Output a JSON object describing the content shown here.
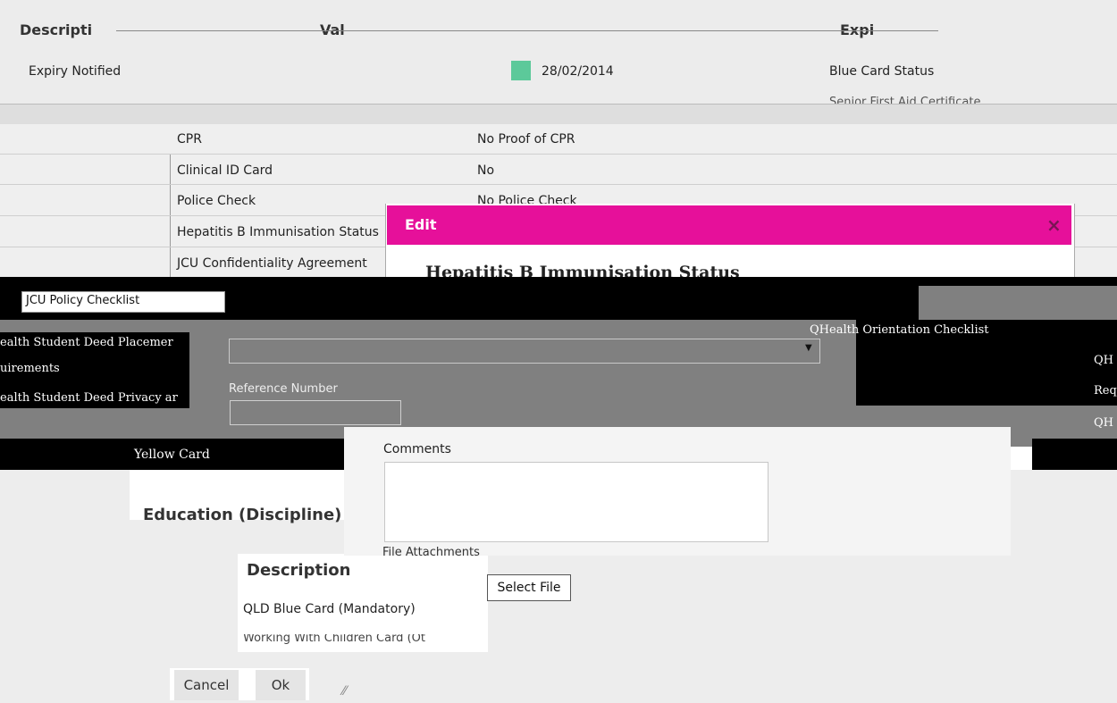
{
  "top_table": {
    "header_labels": [
      "Descripti",
      "Val",
      "Expi"
    ],
    "row": {
      "description": "Expiry Notified",
      "value": "28/02/2014",
      "expiry": "Blue Card Status"
    },
    "partial_next": "Senior First Aid Certificate",
    "status_color": "#5cc99a"
  },
  "requirements": [
    {
      "label": "CPR",
      "value": "No Proof of CPR"
    },
    {
      "label": "Clinical ID Card",
      "value": "No"
    },
    {
      "label": "Police Check",
      "value": "No Police Check"
    },
    {
      "label": "Hepatitis B Immunisation Status",
      "value": ""
    },
    {
      "label": "JCU Confidentiality Agreement",
      "value": ""
    }
  ],
  "dialog": {
    "title": "Edit",
    "close_glyph": "×",
    "heading": "Hepatitis B Immunisation Status",
    "status_select_value": "",
    "reference_label": "Reference Number",
    "reference_value": "",
    "comments_label": "Comments",
    "comments_value": "",
    "file_label": "File Attachments",
    "select_file_label": "Select File",
    "cancel_label": "Cancel",
    "ok_label": "Ok",
    "header_color": "#e6109a"
  },
  "policy": {
    "checklist_label": "JCU Policy Checklist",
    "left_items": [
      "ealth Student Deed Placemer",
      "uirements",
      "ealth Student Deed Privacy ar"
    ],
    "yellow_card": "Yellow Card",
    "right_heading": "QHealth Orientation Checklist",
    "right_items": [
      "QH",
      "Req",
      "QH"
    ]
  },
  "education": {
    "heading": "Education (Discipline)",
    "col_description": "Description",
    "items": [
      "QLD Blue Card (Mandatory)",
      "Working With Children Card (Ot"
    ]
  }
}
